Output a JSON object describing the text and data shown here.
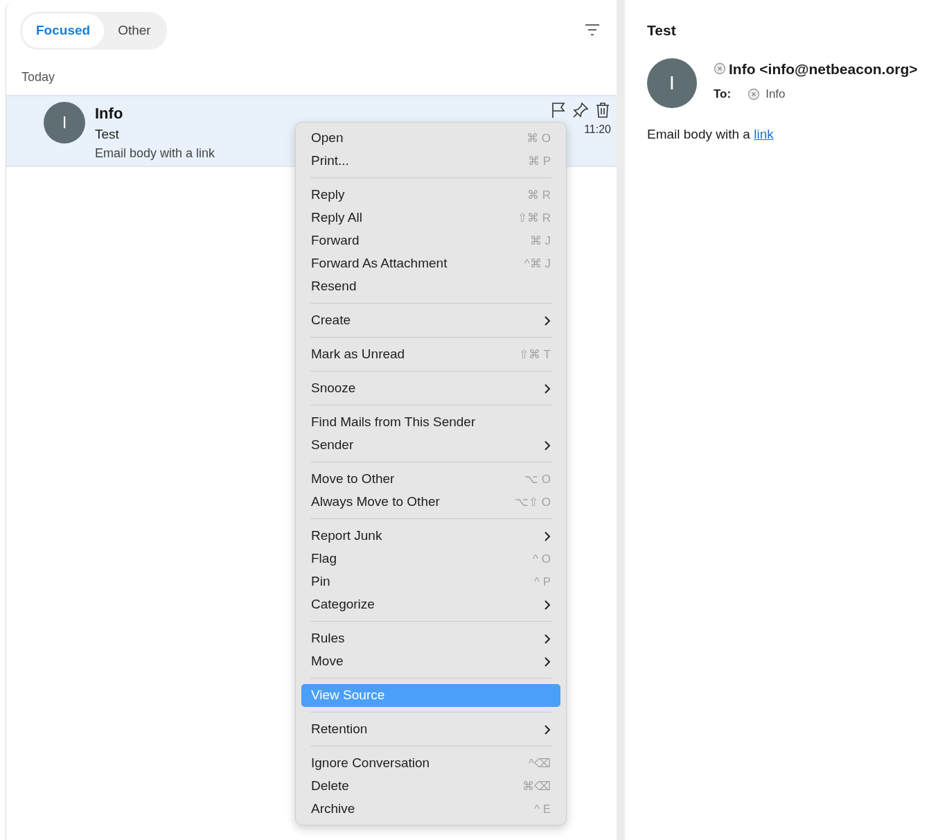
{
  "tabs": [
    {
      "label": "Focused",
      "selected": true
    },
    {
      "label": "Other",
      "selected": false
    }
  ],
  "list": {
    "group_label": "Today",
    "messages": [
      {
        "initial": "I",
        "sender": "Info",
        "subject": "Test",
        "preview": "Email body with a link",
        "time": "11:20",
        "selected": true
      }
    ]
  },
  "context_menu": {
    "groups": [
      {
        "items": [
          {
            "label": "Open",
            "kind": "command",
            "shortcut": "⌘ O",
            "selected": false
          },
          {
            "label": "Print...",
            "kind": "command",
            "shortcut": "⌘ P",
            "selected": false
          }
        ]
      },
      {
        "items": [
          {
            "label": "Reply",
            "kind": "command",
            "shortcut": "⌘ R",
            "selected": false
          },
          {
            "label": "Reply All",
            "kind": "command",
            "shortcut": "⇧⌘ R",
            "selected": false
          },
          {
            "label": "Forward",
            "kind": "command",
            "shortcut": "⌘ J",
            "selected": false
          },
          {
            "label": "Forward As Attachment",
            "kind": "command",
            "shortcut": "^⌘ J",
            "selected": false
          },
          {
            "label": "Resend",
            "kind": "command",
            "selected": false
          }
        ]
      },
      {
        "items": [
          {
            "label": "Create",
            "kind": "submenu",
            "selected": false
          }
        ]
      },
      {
        "items": [
          {
            "label": "Mark as Unread",
            "kind": "command",
            "shortcut": "⇧⌘ T",
            "selected": false
          }
        ]
      },
      {
        "items": [
          {
            "label": "Snooze",
            "kind": "submenu",
            "selected": false
          }
        ]
      },
      {
        "items": [
          {
            "label": "Find Mails from This Sender",
            "kind": "command",
            "selected": false
          },
          {
            "label": "Sender",
            "kind": "submenu",
            "selected": false
          }
        ]
      },
      {
        "items": [
          {
            "label": "Move to Other",
            "kind": "command",
            "shortcut": "⌥ O",
            "selected": false
          },
          {
            "label": "Always Move to Other",
            "kind": "command",
            "shortcut": "⌥⇧ O",
            "selected": false
          }
        ]
      },
      {
        "items": [
          {
            "label": "Report Junk",
            "kind": "submenu",
            "selected": false
          },
          {
            "label": "Flag",
            "kind": "command",
            "shortcut": "^ O",
            "selected": false
          },
          {
            "label": "Pin",
            "kind": "command",
            "shortcut": "^ P",
            "selected": false
          },
          {
            "label": "Categorize",
            "kind": "submenu",
            "selected": false
          }
        ]
      },
      {
        "items": [
          {
            "label": "Rules",
            "kind": "submenu",
            "selected": false
          },
          {
            "label": "Move",
            "kind": "submenu",
            "selected": false
          }
        ]
      },
      {
        "items": [
          {
            "label": "View Source",
            "kind": "command",
            "selected": true
          }
        ]
      },
      {
        "items": [
          {
            "label": "Retention",
            "kind": "submenu",
            "selected": false
          }
        ]
      },
      {
        "items": [
          {
            "label": "Ignore Conversation",
            "kind": "command",
            "shortcut": "^⌫",
            "selected": false
          },
          {
            "label": "Delete",
            "kind": "command",
            "shortcut": "⌘⌫",
            "selected": false
          },
          {
            "label": "Archive",
            "kind": "command",
            "shortcut": "^ E",
            "selected": false
          }
        ]
      }
    ]
  },
  "reading_pane": {
    "subject": "Test",
    "initial": "I",
    "from": "Info <info@netbeacon.org>",
    "to_label": "To:",
    "to": "Info",
    "body": "Email body with a ",
    "body_link": "link"
  }
}
